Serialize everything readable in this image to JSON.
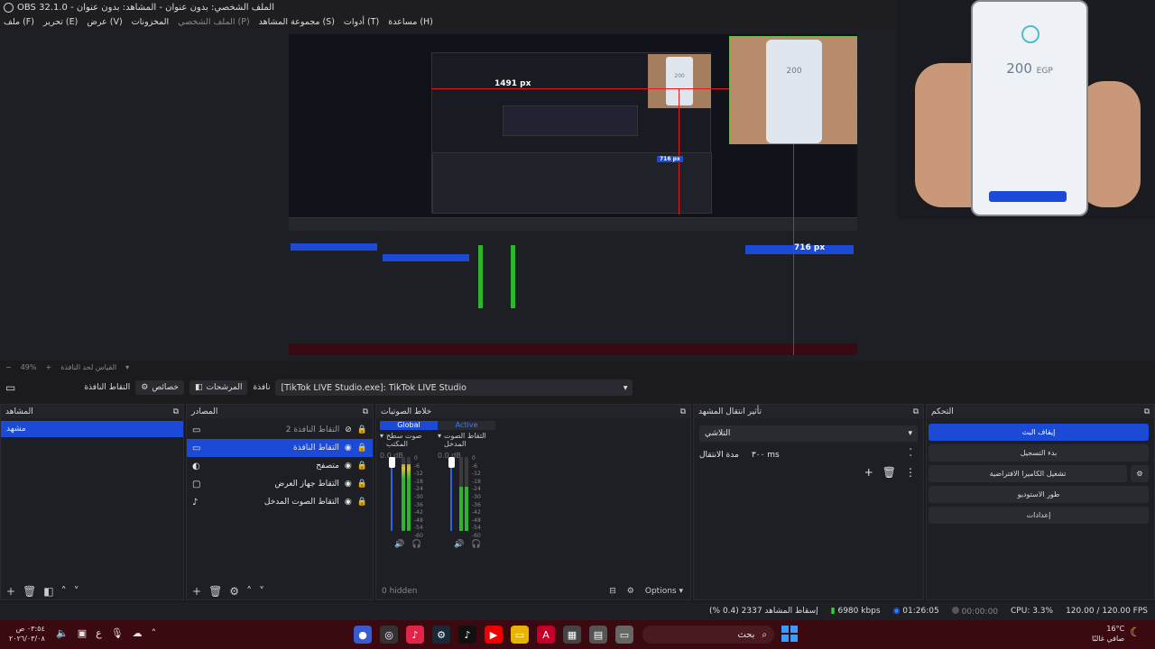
{
  "window": {
    "title": "OBS 32.1.0 - الملف الشخصي: بدون عنوان - المشاهد: بدون عنوان"
  },
  "menu": {
    "items": [
      {
        "label": "ملف (F)",
        "dim": false
      },
      {
        "label": "تحرير (E)",
        "dim": false
      },
      {
        "label": "عرض (V)",
        "dim": false
      },
      {
        "label": "المخزونات",
        "dim": false
      },
      {
        "label": "الملف الشخصي (P)",
        "dim": true
      },
      {
        "label": "مجموعة المشاهد (S)",
        "dim": false
      },
      {
        "label": "أدوات (T)",
        "dim": false
      },
      {
        "label": "مساعدة (H)",
        "dim": false
      }
    ]
  },
  "preview": {
    "measure_width": "1491 px",
    "measure_height": "716 px",
    "nested_measure_height": "716 px",
    "phone_amount": "200",
    "phone_currency": "EGP",
    "nested_phone_amount": "200"
  },
  "zoom_row": {
    "zoom": "49%",
    "label": "القياس لحد النافذة"
  },
  "toolbar": {
    "window_capture": "التقاط النافذة",
    "properties": "خصائص",
    "filters": "المرشحات",
    "window_label": "نافذة",
    "window_value": "[TikTok LIVE Studio.exe]: TikTok LIVE Studio"
  },
  "scenes": {
    "title": "المشاهد",
    "items": [
      "مشهد"
    ]
  },
  "sources": {
    "title": "المصادر",
    "items": [
      {
        "name": "التقاط النافذة 2",
        "icon": "window",
        "visible": false,
        "selected": false
      },
      {
        "name": "التقاط النافذة",
        "icon": "window",
        "visible": true,
        "selected": true
      },
      {
        "name": "متصفح",
        "icon": "browser",
        "visible": true,
        "selected": false
      },
      {
        "name": "التقاط جهاز العرض",
        "icon": "monitor",
        "visible": true,
        "selected": false
      },
      {
        "name": "التقاط الصوت المدخل",
        "icon": "mic",
        "visible": true,
        "selected": false
      }
    ]
  },
  "mixer": {
    "title": "خلاط الصوتيات",
    "tabs": [
      "Global",
      "Active"
    ],
    "channels": [
      {
        "name": "صوت سطح المكتب",
        "db": "0.0 dB",
        "level": 0.9,
        "fader": 1.0
      },
      {
        "name": "التقاط الصوت المدخل",
        "db": "0.0 dB",
        "level": 0.6,
        "fader": 1.0
      }
    ],
    "scale": [
      "0",
      "-6",
      "-12",
      "-18",
      "-24",
      "-30",
      "-36",
      "-42",
      "-48",
      "-54",
      "-60"
    ],
    "hidden_count": "0 hidden",
    "options_label": "Options"
  },
  "transitions": {
    "title": "تأثير انتقال المشهد",
    "type": "التلاشي",
    "duration_label": "مدة الانتقال",
    "duration_value": "٣٠٠ ms"
  },
  "controls": {
    "title": "التحكم",
    "stop_stream": "إيقاف البث",
    "start_recording": "بدء التسجيل",
    "virtual_camera": "تشغيل الكاميرا الافتراضية",
    "studio_mode": "طور الاستوديو",
    "settings": "إعدادات"
  },
  "status": {
    "dropped": "إسقاط المشاهد 2337 (0.4 %)",
    "bitrate": "6980 kbps",
    "stream_time": "01:26:05",
    "record_time": "00:00:00",
    "cpu": "CPU: 3.3%",
    "fps": "120.00 / 120.00 FPS"
  },
  "taskbar": {
    "time": "٠٣:٥٤ ص",
    "date": "٢٠٢٦/٠٣/٠٨",
    "lang": "ع",
    "search": "بحث",
    "temp": "16°C",
    "weather": "صافي غالبًا"
  },
  "colors": {
    "accent": "#1b4bd6",
    "measure_red": "#e01a1a",
    "selection_green": "#3ad13a",
    "taskbar_bg": "#3a0a10"
  }
}
